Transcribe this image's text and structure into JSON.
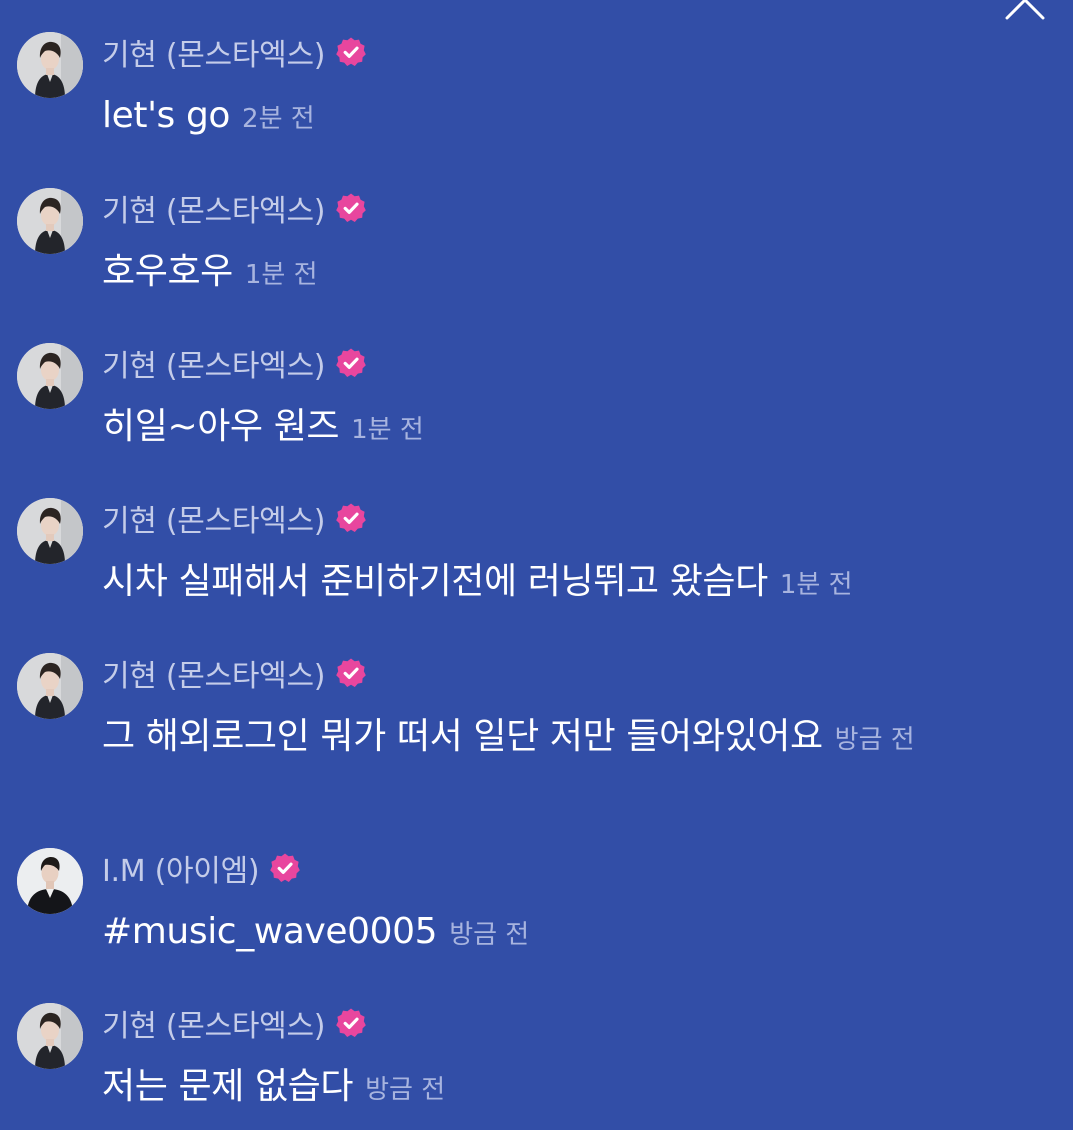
{
  "close_icon": "close-icon",
  "verified_color": "#e8469e",
  "background_color": "#324ea7",
  "messages": [
    {
      "sender": "기현 (몬스타엑스)",
      "text": "let's go",
      "time": "2분 전",
      "verified": true
    },
    {
      "sender": "기현 (몬스타엑스)",
      "text": "호우호우",
      "time": "1분 전",
      "verified": true
    },
    {
      "sender": "기현 (몬스타엑스)",
      "text": "히일~아우 원즈",
      "time": "1분 전",
      "verified": true
    },
    {
      "sender": "기현 (몬스타엑스)",
      "text": "시차 실패해서 준비하기전에 러닝뛰고 왔슴다",
      "time": "1분 전",
      "verified": true
    },
    {
      "sender": "기현 (몬스타엑스)",
      "text": "그 해외로그인 뭐가 떠서 일단 저만 들어와있어요",
      "time": "방금 전",
      "verified": true
    },
    {
      "sender": "I.M (아이엠)",
      "text": "#music_wave0005",
      "time": "방금 전",
      "verified": true
    },
    {
      "sender": "기현 (몬스타엑스)",
      "text": "저는 문제 없습다",
      "time": "방금 전",
      "verified": true
    }
  ]
}
